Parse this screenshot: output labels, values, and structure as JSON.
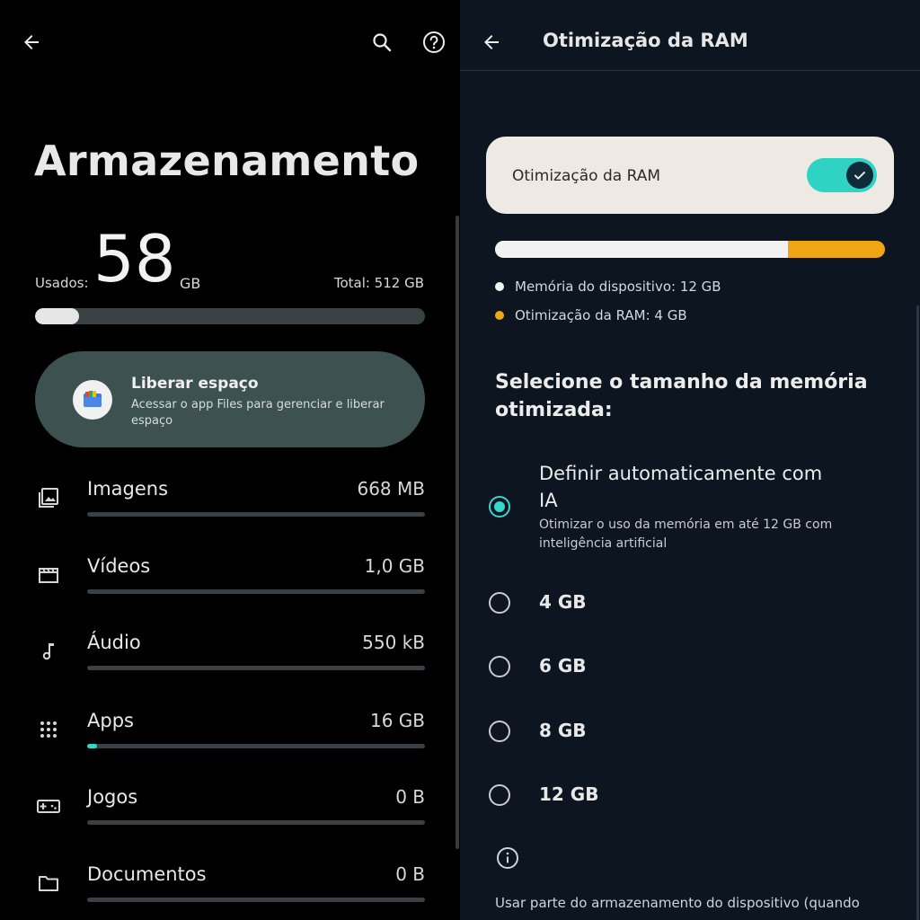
{
  "storage": {
    "title": "Armazenamento",
    "used_label": "Usados:",
    "used_value": "58",
    "used_unit": "GB",
    "total_label": "Total: 512 GB",
    "used_fraction": 0.113,
    "free_space": {
      "title": "Liberar espaço",
      "subtitle": "Acessar o app Files para gerenciar e liberar espaço"
    },
    "categories": [
      {
        "name": "Imagens",
        "size": "668 MB",
        "fraction": 0.0,
        "icon": "image-icon"
      },
      {
        "name": "Vídeos",
        "size": "1,0 GB",
        "fraction": 0.0,
        "icon": "video-icon"
      },
      {
        "name": "Áudio",
        "size": "550 kB",
        "fraction": 0.0,
        "icon": "music-note-icon"
      },
      {
        "name": "Apps",
        "size": "16 GB",
        "fraction": 0.03,
        "icon": "apps-grid-icon"
      },
      {
        "name": "Jogos",
        "size": "0 B",
        "fraction": 0.0,
        "icon": "gamepad-icon"
      },
      {
        "name": "Documentos",
        "size": "0 B",
        "fraction": 0.0,
        "icon": "folder-icon"
      }
    ]
  },
  "ram": {
    "title": "Otimização da RAM",
    "toggle_label": "Otimização da RAM",
    "toggle_on": true,
    "device_fraction": 0.75,
    "legend": [
      {
        "label": "Memória do dispositivo: 12 GB",
        "color": "#f2f2f2"
      },
      {
        "label": "Otimização da RAM: 4 GB",
        "color": "#f0a514"
      }
    ],
    "heading": "Selecione o tamanho da memória otimizada:",
    "auto_option": {
      "title": "Definir automaticamente com IA",
      "subtitle": "Otimizar o uso da memória em até 12 GB com inteligência artificial",
      "selected": true
    },
    "options": [
      "4 GB",
      "6 GB",
      "8 GB",
      "12 GB"
    ],
    "info_text": "Usar parte do armazenamento do dispositivo (quando"
  },
  "colors": {
    "accent": "#35d6cc",
    "orange": "#f0a514",
    "card_green": "#3c5150"
  }
}
